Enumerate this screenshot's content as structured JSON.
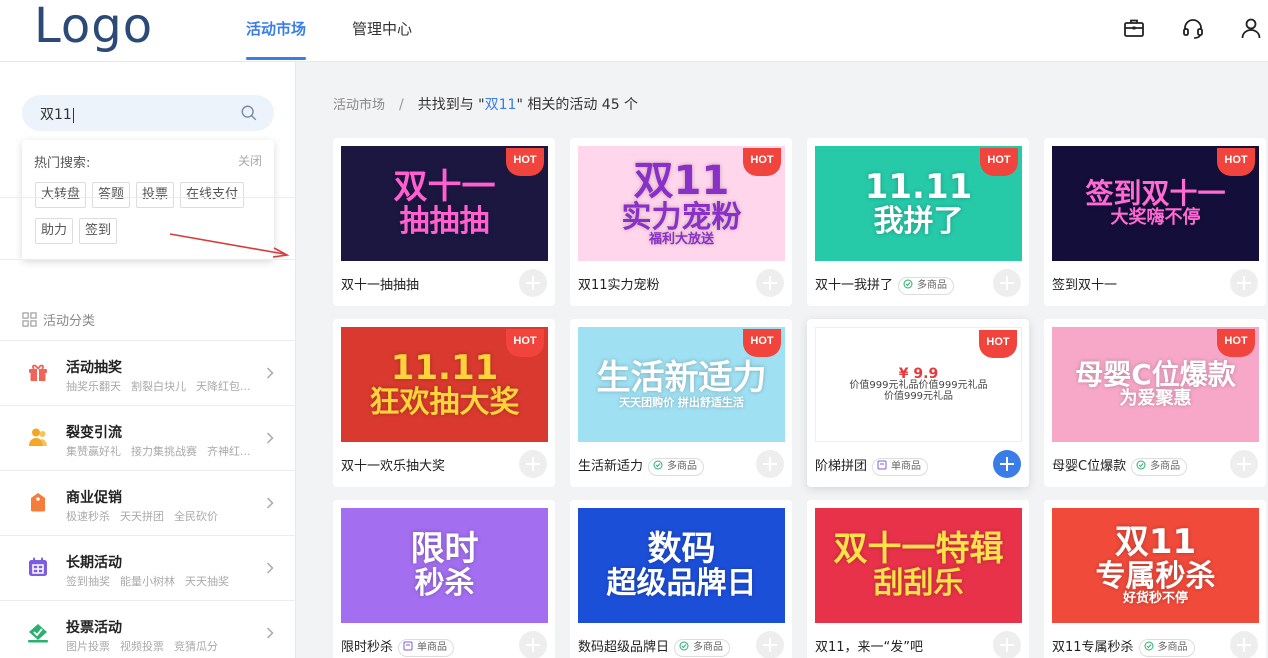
{
  "header": {
    "logo": "Logo",
    "tabs": [
      {
        "label": "活动市场",
        "active": true
      },
      {
        "label": "管理中心",
        "active": false
      }
    ],
    "icons": [
      "briefcase-icon",
      "headset-icon",
      "user-icon"
    ]
  },
  "search": {
    "value": "双11",
    "hot_title": "热门搜索:",
    "close_label": "关闭",
    "tags": [
      "大转盘",
      "答题",
      "投票",
      "在线支付",
      "助力",
      "签到"
    ]
  },
  "categories": {
    "title": "活动分类",
    "items": [
      {
        "name": "活动抽奖",
        "subs": [
          "抽奖乐翻天",
          "割裂白块儿",
          "天降红包..."
        ],
        "icon": "gift-icon",
        "color": "#f0645a"
      },
      {
        "name": "裂变引流",
        "subs": [
          "集赞赢好礼",
          "接力集挑战赛",
          "齐神红..."
        ],
        "icon": "people-icon",
        "color": "#f5a623"
      },
      {
        "name": "商业促销",
        "subs": [
          "极速秒杀",
          "天天拼团",
          "全民砍价"
        ],
        "icon": "tag-icon",
        "color": "#f57c3a"
      },
      {
        "name": "长期活动",
        "subs": [
          "签到抽奖",
          "能量小树林",
          "天天抽奖"
        ],
        "icon": "calendar-icon",
        "color": "#7c5ce0"
      },
      {
        "name": "投票活动",
        "subs": [
          "图片投票",
          "视频投票",
          "竞猜瓜分"
        ],
        "icon": "vote-icon",
        "color": "#2ab06f"
      }
    ]
  },
  "breadcrumb": {
    "root": "活动市场",
    "prefix": "共找到与 \"",
    "keyword": "双11",
    "suffix": "\" 相关的活动 45 个"
  },
  "cards": [
    {
      "name": "双十一抽抽抽",
      "badge": "",
      "hot": "HOT",
      "lines": [
        "双十一",
        "抽抽抽"
      ],
      "bg": "#1c1740",
      "fg": "#ff5fd1"
    },
    {
      "name": "双11实力宠粉",
      "badge": "",
      "hot": "HOT",
      "lines": [
        "双11",
        "实力宠粉",
        "福利大放送"
      ],
      "bg": "#ffd6ec",
      "fg": "#8b2fc9"
    },
    {
      "name": "双十一我拼了",
      "badge": "多商品",
      "hot": "HOT",
      "lines": [
        "11.11",
        "我拼了"
      ],
      "bg": "#26c9a8",
      "fg": "#ffffff"
    },
    {
      "name": "签到双十一",
      "badge": "",
      "hot": "HOT",
      "lines": [
        "签到双十一",
        "大奖嗨不停"
      ],
      "bg": "#140f3a",
      "fg": "#ff6ad5"
    },
    {
      "name": "双十一欢乐抽大奖",
      "badge": "",
      "hot": "HOT",
      "lines": [
        "11.11",
        "狂欢抽大奖"
      ],
      "bg": "#d9392f",
      "fg": "#ffd43a"
    },
    {
      "name": "生活新适力",
      "badge": "多商品",
      "hot": "HOT",
      "lines": [
        "生活新适力",
        "天天团购价 拼出舒适生活"
      ],
      "bg": "#9fe0f2",
      "fg": "#ffffff"
    },
    {
      "name": "阶梯拼团",
      "badge": "单商品",
      "hot": "HOT",
      "lines": [
        "¥ 9.9",
        "价值999元礼品价值999元礼品",
        "价值999元礼品"
      ],
      "bg": "#ffffff",
      "fg": "#e8383d"
    },
    {
      "name": "母婴C位爆款",
      "badge": "多商品",
      "hot": "HOT",
      "lines": [
        "母婴C位爆款",
        "为爱聚惠"
      ],
      "bg": "#f7a8c8",
      "fg": "#ffffff"
    },
    {
      "name": "限时秒杀",
      "badge": "单商品",
      "hot": "",
      "lines": [
        "限时",
        "秒杀"
      ],
      "bg": "#a36ef0",
      "fg": "#ffffff"
    },
    {
      "name": "数码超级品牌日",
      "badge": "多商品",
      "hot": "",
      "lines": [
        "数码",
        "超级品牌日"
      ],
      "bg": "#1c4fd8",
      "fg": "#ffffff"
    },
    {
      "name": "双11，来一“发”吧",
      "badge": "",
      "hot": "",
      "lines": [
        "双十一特辑",
        "刮刮乐"
      ],
      "bg": "#e8324a",
      "fg": "#ffe14a"
    },
    {
      "name": "双11专属秒杀",
      "badge": "多商品",
      "hot": "",
      "lines": [
        "双11",
        "专属秒杀",
        "好货秒不停"
      ],
      "bg": "#f04a3a",
      "fg": "#ffffff"
    }
  ]
}
